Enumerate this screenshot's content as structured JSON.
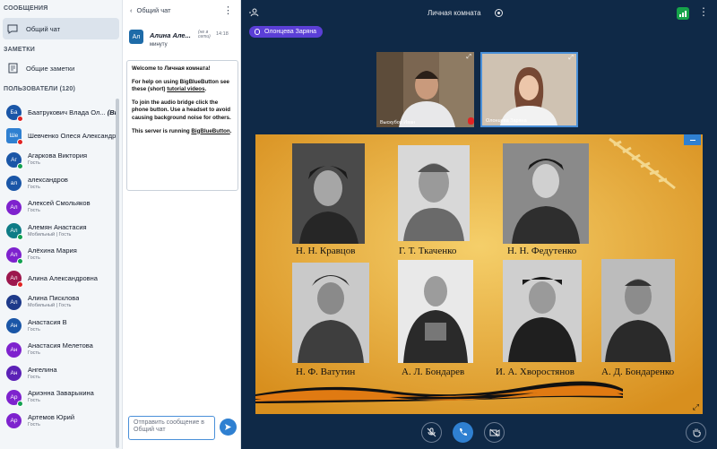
{
  "sidebar": {
    "messages_title": "СООБЩЕНИЯ",
    "public_chat": "Общий чат",
    "notes_title": "ЗАМЕТКИ",
    "shared_notes": "Общие заметки",
    "users_title": "ПОЛЬЗОВАТЕЛИ (120)",
    "users": [
      {
        "initials": "Ба",
        "name": "Баатрукович Владa Ол...",
        "you": "(Вы)",
        "role": "",
        "color": "#1a56a7",
        "square": false,
        "mic": "red"
      },
      {
        "initials": "Ше",
        "name": "Шевченко Олеся Александр...",
        "you": "",
        "role": "",
        "color": "#2f80d1",
        "square": true,
        "mic": "red"
      },
      {
        "initials": "Аг",
        "name": "Агаркова Виктория",
        "you": "",
        "role": "Гость",
        "color": "#1a56a7",
        "square": false,
        "mic": "green"
      },
      {
        "initials": "ал",
        "name": "александров",
        "you": "",
        "role": "Гость",
        "color": "#1a56a7",
        "square": false,
        "mic": ""
      },
      {
        "initials": "Ал",
        "name": "Алексей Смольяков",
        "you": "",
        "role": "Гость",
        "color": "#7e22ce",
        "square": false,
        "mic": ""
      },
      {
        "initials": "Ал",
        "name": "Алемян Анастасия",
        "you": "",
        "role": "Мобильный | Гость",
        "color": "#0e7c86",
        "square": false,
        "mic": "green"
      },
      {
        "initials": "Ал",
        "name": "Алёхина Мария",
        "you": "",
        "role": "Гость",
        "color": "#7e22ce",
        "square": false,
        "mic": "green"
      },
      {
        "initials": "Ал",
        "name": "Алина Александровна",
        "you": "",
        "role": "",
        "color": "#9d174d",
        "square": false,
        "mic": "red"
      },
      {
        "initials": "Ал",
        "name": "Алина Писклова",
        "you": "",
        "role": "Мобильный | Гость",
        "color": "#1e3a8a",
        "square": false,
        "mic": ""
      },
      {
        "initials": "Ан",
        "name": "Анастасия В",
        "you": "",
        "role": "Гость",
        "color": "#1a56a7",
        "square": false,
        "mic": ""
      },
      {
        "initials": "Ан",
        "name": "Анастасия Мелетова",
        "you": "",
        "role": "Гость",
        "color": "#7e22ce",
        "square": false,
        "mic": ""
      },
      {
        "initials": "Ан",
        "name": "Ангелина",
        "you": "",
        "role": "Гость",
        "color": "#5b21b6",
        "square": false,
        "mic": ""
      },
      {
        "initials": "Ар",
        "name": "Ариэнна Заварыкина",
        "you": "",
        "role": "Гость",
        "color": "#7e22ce",
        "square": false,
        "mic": "green"
      },
      {
        "initials": "Ар",
        "name": "Артемов Юрий",
        "you": "",
        "role": "Гость",
        "color": "#7e22ce",
        "square": false,
        "mic": ""
      }
    ]
  },
  "chat": {
    "back_label": "Общий чат",
    "author_initials": "Ал",
    "author": "Алина Але...",
    "tag": "(не в сети)",
    "time": "14:18",
    "sub": "минуту",
    "welcome_title": "Welcome to Личная комната!",
    "help_1": "For help on using BigBlueButton see these (short)",
    "help_link": "tutorial videos",
    "audio_text": "To join the audio bridge click the phone button. Use a headset to avoid causing background noise for others.",
    "server_text": "This server is running",
    "server_link": "BigBlueButton",
    "input_placeholder": "Отправить сообщение в Общий чат"
  },
  "main": {
    "room_title": "Личная комната",
    "talking": "Олонцева Заряна",
    "cam_left_label": "Выскубов Иван",
    "cam_right_label": "Олонцева Заряна"
  },
  "slide": {
    "captions": [
      "Н. Н. Кравцов",
      "Г. Т. Ткаченко",
      "Н. Н. Федутенко",
      "Н. Ф. Ватутин",
      "А. Л. Бондарев",
      "И. А. Хворостянов",
      "А. Д. Бондаренко"
    ]
  }
}
